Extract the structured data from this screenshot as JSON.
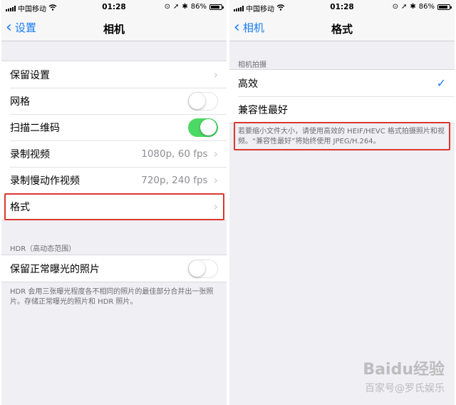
{
  "left": {
    "status": {
      "carrier": "中国移动",
      "time": "01:28",
      "battery": "86%"
    },
    "nav": {
      "back": "设置",
      "title": "相机"
    },
    "rows": [
      {
        "label": "保留设置"
      },
      {
        "label": "网格",
        "toggle": false
      },
      {
        "label": "扫描二维码",
        "toggle": true
      },
      {
        "label": "录制视频",
        "detail": "1080p, 60 fps"
      },
      {
        "label": "录制慢动作视频",
        "detail": "720p, 240 fps"
      },
      {
        "label": "格式"
      }
    ],
    "hdr_header": "HDR（高动态范围）",
    "hdr_row": {
      "label": "保留正常曝光的照片",
      "toggle": false
    },
    "hdr_footnote": "HDR 会用三张曝光程度各不相同的照片的最佳部分合并出一张照片。存储正常曝光的照片和 HDR 照片。"
  },
  "right": {
    "status": {
      "carrier": "中国移动",
      "time": "01:28",
      "battery": "86%"
    },
    "nav": {
      "back": "相机",
      "title": "格式"
    },
    "section_header": "相机拍摄",
    "options": [
      {
        "label": "高效",
        "selected": true
      },
      {
        "label": "兼容性最好",
        "selected": false
      }
    ],
    "footnote": "若要缩小文件大小，请使用高效的 HEIF/HEVC 格式拍摄照片和视频。“兼容性最好”将始终使用 JPEG/H.264。"
  },
  "watermark": {
    "main": "Baidu经验",
    "sub": "百家号@罗氏娱乐"
  },
  "colors": {
    "accent": "#1a7cf5",
    "toggle_on": "#4cd964",
    "highlight": "#d9382e"
  }
}
